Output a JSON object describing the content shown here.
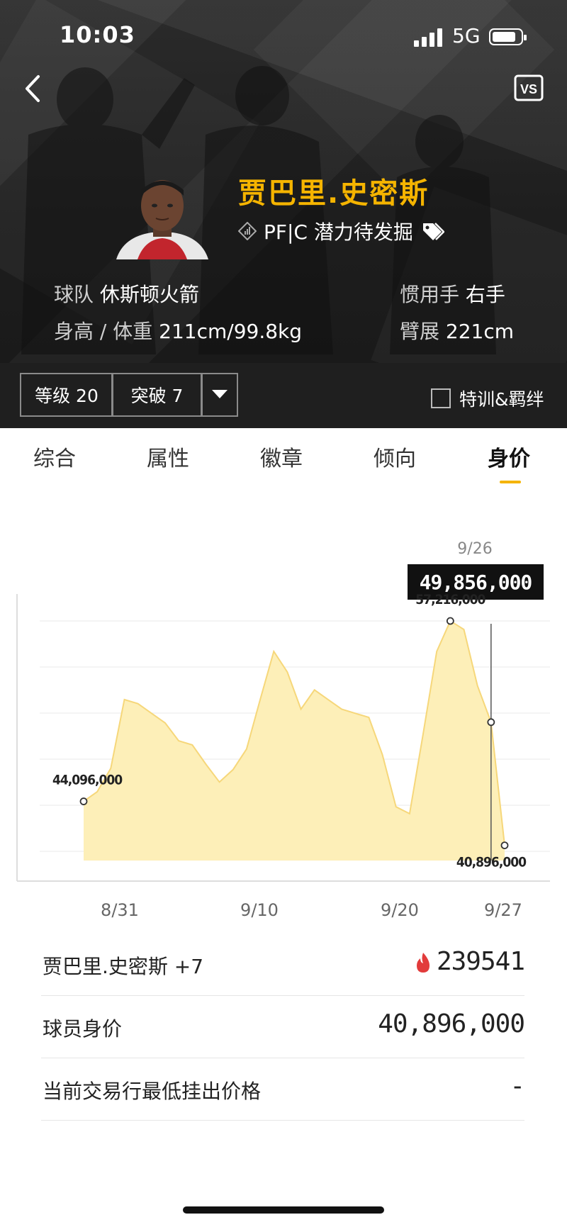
{
  "status_bar": {
    "time": "10:03",
    "network": "5G"
  },
  "header": {
    "player_name": "贾巴里.史密斯",
    "position": "PF|C 潜力待发掘",
    "team_label": "球队",
    "team": "休斯顿火箭",
    "hand_label": "惯用手",
    "hand": "右手",
    "hw_label": "身高 / 体重",
    "hw": "211cm/99.8kg",
    "wingspan_label": "臂展",
    "wingspan": "221cm"
  },
  "toolbar": {
    "level": "等级 20",
    "breakthrough": "突破 7",
    "training_label": "特训&羁绊"
  },
  "tabs": [
    "综合",
    "属性",
    "徽章",
    "倾向",
    "身价"
  ],
  "active_tab": "身价",
  "tooltip": {
    "date": "9/26",
    "value": "49,856,000"
  },
  "chart_data": {
    "type": "area",
    "x": [
      "8/27",
      "8/28",
      "8/29",
      "8/30",
      "8/31",
      "9/1",
      "9/2",
      "9/3",
      "9/4",
      "9/5",
      "9/6",
      "9/7",
      "9/8",
      "9/9",
      "9/10",
      "9/11",
      "9/12",
      "9/13",
      "9/14",
      "9/15",
      "9/16",
      "9/17",
      "9/18",
      "9/19",
      "9/20",
      "9/21",
      "9/22",
      "9/23",
      "9/24",
      "9/25",
      "9/26",
      "9/27"
    ],
    "values": [
      44096000,
      44800000,
      46500000,
      51500000,
      51200000,
      50500000,
      49800000,
      48500000,
      48200000,
      46800000,
      45500000,
      46400000,
      47900000,
      51500000,
      55000000,
      53500000,
      50800000,
      52200000,
      51500000,
      50800000,
      50500000,
      50200000,
      47500000,
      43700000,
      43200000,
      49000000,
      55000000,
      57216000,
      56600000,
      52500000,
      49856000,
      40896000
    ],
    "x_ticks": [
      "8/31",
      "9/10",
      "9/20",
      "9/27"
    ],
    "labels": [
      {
        "text": "44,096,000"
      },
      {
        "text": "57,216,000"
      },
      {
        "text": "40,896,000"
      }
    ],
    "ylim": [
      40000000,
      60000000
    ],
    "color": "#fdefb8",
    "line_color": "#f6d77a"
  },
  "rows": [
    {
      "label": "贾巴里.史密斯 +7",
      "value": "239541"
    },
    {
      "label": "球员身价",
      "value": "40,896,000"
    },
    {
      "label": "当前交易行最低挂出价格",
      "value": "-"
    }
  ]
}
